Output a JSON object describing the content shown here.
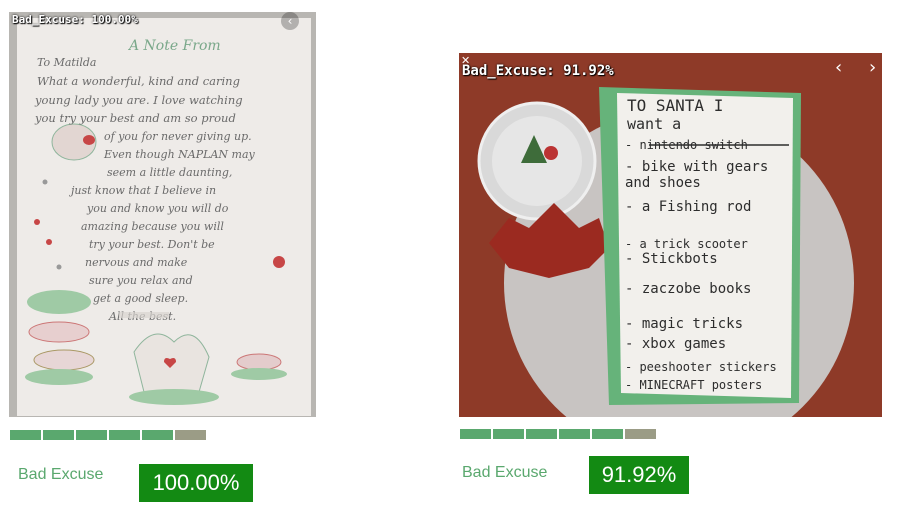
{
  "colors": {
    "accent_green": "#5aa86e",
    "badge_green": "#138a13",
    "segment_green": "#5aa86e",
    "segment_gray": "#9b9c86"
  },
  "cards": [
    {
      "overlay_label": "Bad_Excuse: 100.00%",
      "class_label": "Bad Excuse",
      "score": "100.00%",
      "nav_prev_icon": "chevron-left-icon",
      "image_text": {
        "heading": "A Note From",
        "lines": [
          "To Matilda",
          "What a wonderful, kind and caring",
          "young lady you are. I love watching",
          "you try your best and am so proud",
          "of you for never giving up.",
          "Even though NAPLAN may",
          "seem a little daunting,",
          "just know that I believe in",
          "you and know you will do",
          "amazing because you will",
          "try your best. Don't be",
          "nervous and make",
          "sure you relax and",
          "get a good sleep.",
          "All the best."
        ]
      }
    },
    {
      "overlay_label": "Bad_Excuse: 91.92%",
      "class_label": "Bad Excuse",
      "score": "91.92%",
      "nav_prev_icon": "chevron-left-icon",
      "nav_next_icon": "chevron-right-icon",
      "image_text": {
        "lines": [
          "TO SANTA I",
          "want a",
          "- nintendo switch",
          "- bike with gears",
          "  and shoes",
          "- a Fishing rod",
          "- a trick scooter",
          "- Stickbots",
          "- zaczobe books",
          "- magic tricks",
          "- xbox games",
          "- peeshooter stickers",
          "- MINECRAFT posters"
        ]
      }
    }
  ]
}
